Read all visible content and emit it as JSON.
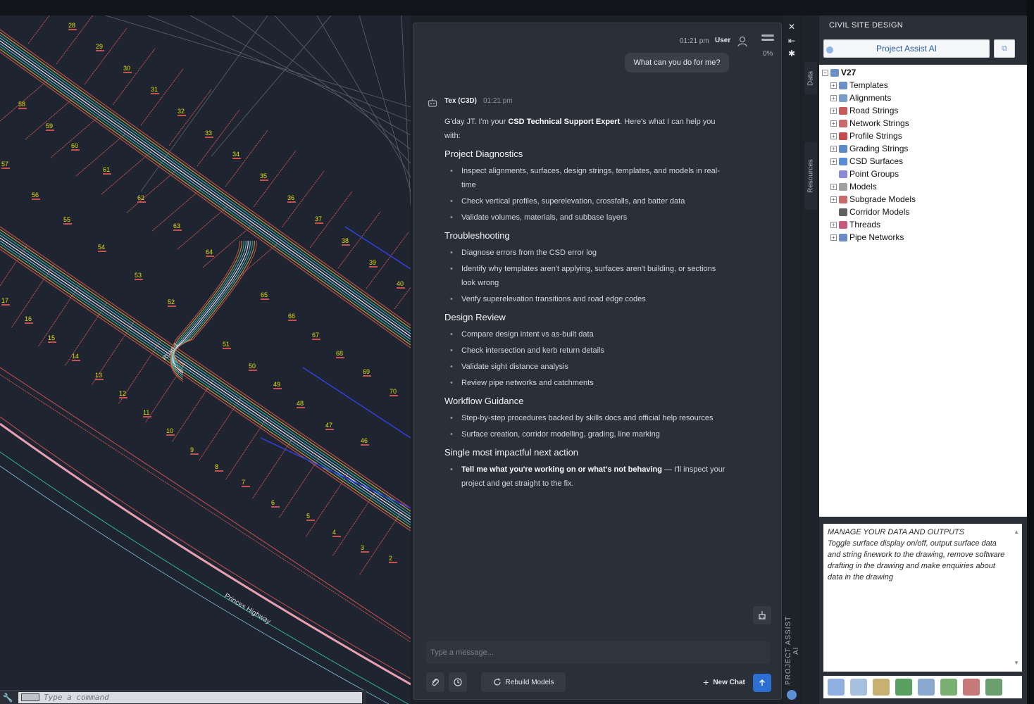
{
  "chat": {
    "header_time": "01:21 pm",
    "header_user": "User",
    "progress_pct": "0%",
    "user_message": "What can you do for me?",
    "bot_name": "Tex (C3D)",
    "bot_time": "01:21 pm",
    "intro_prefix": "G'day JT. I'm your ",
    "intro_bold": "CSD Technical Support Expert",
    "intro_suffix": ". Here's what I can help you with:",
    "sections": [
      {
        "heading": "Project Diagnostics",
        "items": [
          "Inspect alignments, surfaces, design strings, templates, and models in real-time",
          "Check vertical profiles, superelevation, crossfalls, and batter data",
          "Validate volumes, materials, and subbase layers"
        ]
      },
      {
        "heading": "Troubleshooting",
        "items": [
          "Diagnose errors from the CSD error log",
          "Identify why templates aren't applying, surfaces aren't building, or sections look wrong",
          "Verify superelevation transitions and road edge codes"
        ]
      },
      {
        "heading": "Design Review",
        "items": [
          "Compare design intent vs as-built data",
          "Check intersection and kerb return details",
          "Validate sight distance analysis",
          "Review pipe networks and catchments"
        ]
      },
      {
        "heading": "Workflow Guidance",
        "items": [
          "Step-by-step procedures backed by skills docs and official help resources",
          "Surface creation, corridor modelling, grading, line marking"
        ]
      }
    ],
    "next_heading": "Single most impactful next action",
    "next_bold": "Tell me what you're working on or what's not behaving",
    "next_rest": " — I'll inspect your project and get straight to the fix.",
    "input_placeholder": "Type a message...",
    "rebuild_label": "Rebuild Models",
    "newchat_label": "New Chat",
    "side_label": "PROJECT ASSIST AI"
  },
  "tabs": [
    "Data",
    "Resources"
  ],
  "right": {
    "title": "CIVIL SITE DESIGN",
    "assist_button": "Project Assist AI",
    "root": "V27",
    "tree_items": [
      {
        "label": "Templates",
        "color": "#6b8fc9"
      },
      {
        "label": "Alignments",
        "color": "#7a9cc8"
      },
      {
        "label": "Road Strings",
        "color": "#c85a5a"
      },
      {
        "label": "Network Strings",
        "color": "#c86a6a"
      },
      {
        "label": "Profile Strings",
        "color": "#c84a4a"
      },
      {
        "label": "Grading Strings",
        "color": "#5a8ac8"
      },
      {
        "label": "CSD Surfaces",
        "color": "#5a8ad8"
      },
      {
        "label": "Point Groups",
        "color": "#8a8ad8"
      },
      {
        "label": "Models",
        "color": "#a0a0a0"
      },
      {
        "label": "Subgrade Models",
        "color": "#c86a6a"
      },
      {
        "label": "Corridor Models",
        "color": "#606060"
      },
      {
        "label": "Threads",
        "color": "#c85a7a"
      },
      {
        "label": "Pipe Networks",
        "color": "#6a8ac8"
      }
    ],
    "desc_title": "MANAGE YOUR DATA AND OUTPUTS",
    "desc_body": "Toggle surface display on/off, output surface data and string linework to the drawing, remove software drafting in the drawing and make enquiries about data in the drawing"
  },
  "cad": {
    "command_placeholder": "Type a command",
    "road_label": "Road 1",
    "highway_label": "Princes Highway",
    "lot_numbers": [
      "28",
      "29",
      "30",
      "31",
      "32",
      "33",
      "34",
      "35",
      "36",
      "37",
      "38",
      "39",
      "40",
      "58",
      "59",
      "60",
      "61",
      "62",
      "63",
      "64",
      "65",
      "66",
      "67",
      "68",
      "69",
      "70",
      "57",
      "56",
      "55",
      "54",
      "53",
      "52",
      "51",
      "50",
      "49",
      "48",
      "47",
      "46",
      "17",
      "16",
      "15",
      "14",
      "13",
      "12",
      "11",
      "10",
      "9",
      "8",
      "7",
      "6",
      "5",
      "4",
      "3",
      "2"
    ]
  },
  "colors": {
    "accent": "#2a6fd1",
    "lot_label": "#e4e000",
    "boundary": "#c85050"
  }
}
